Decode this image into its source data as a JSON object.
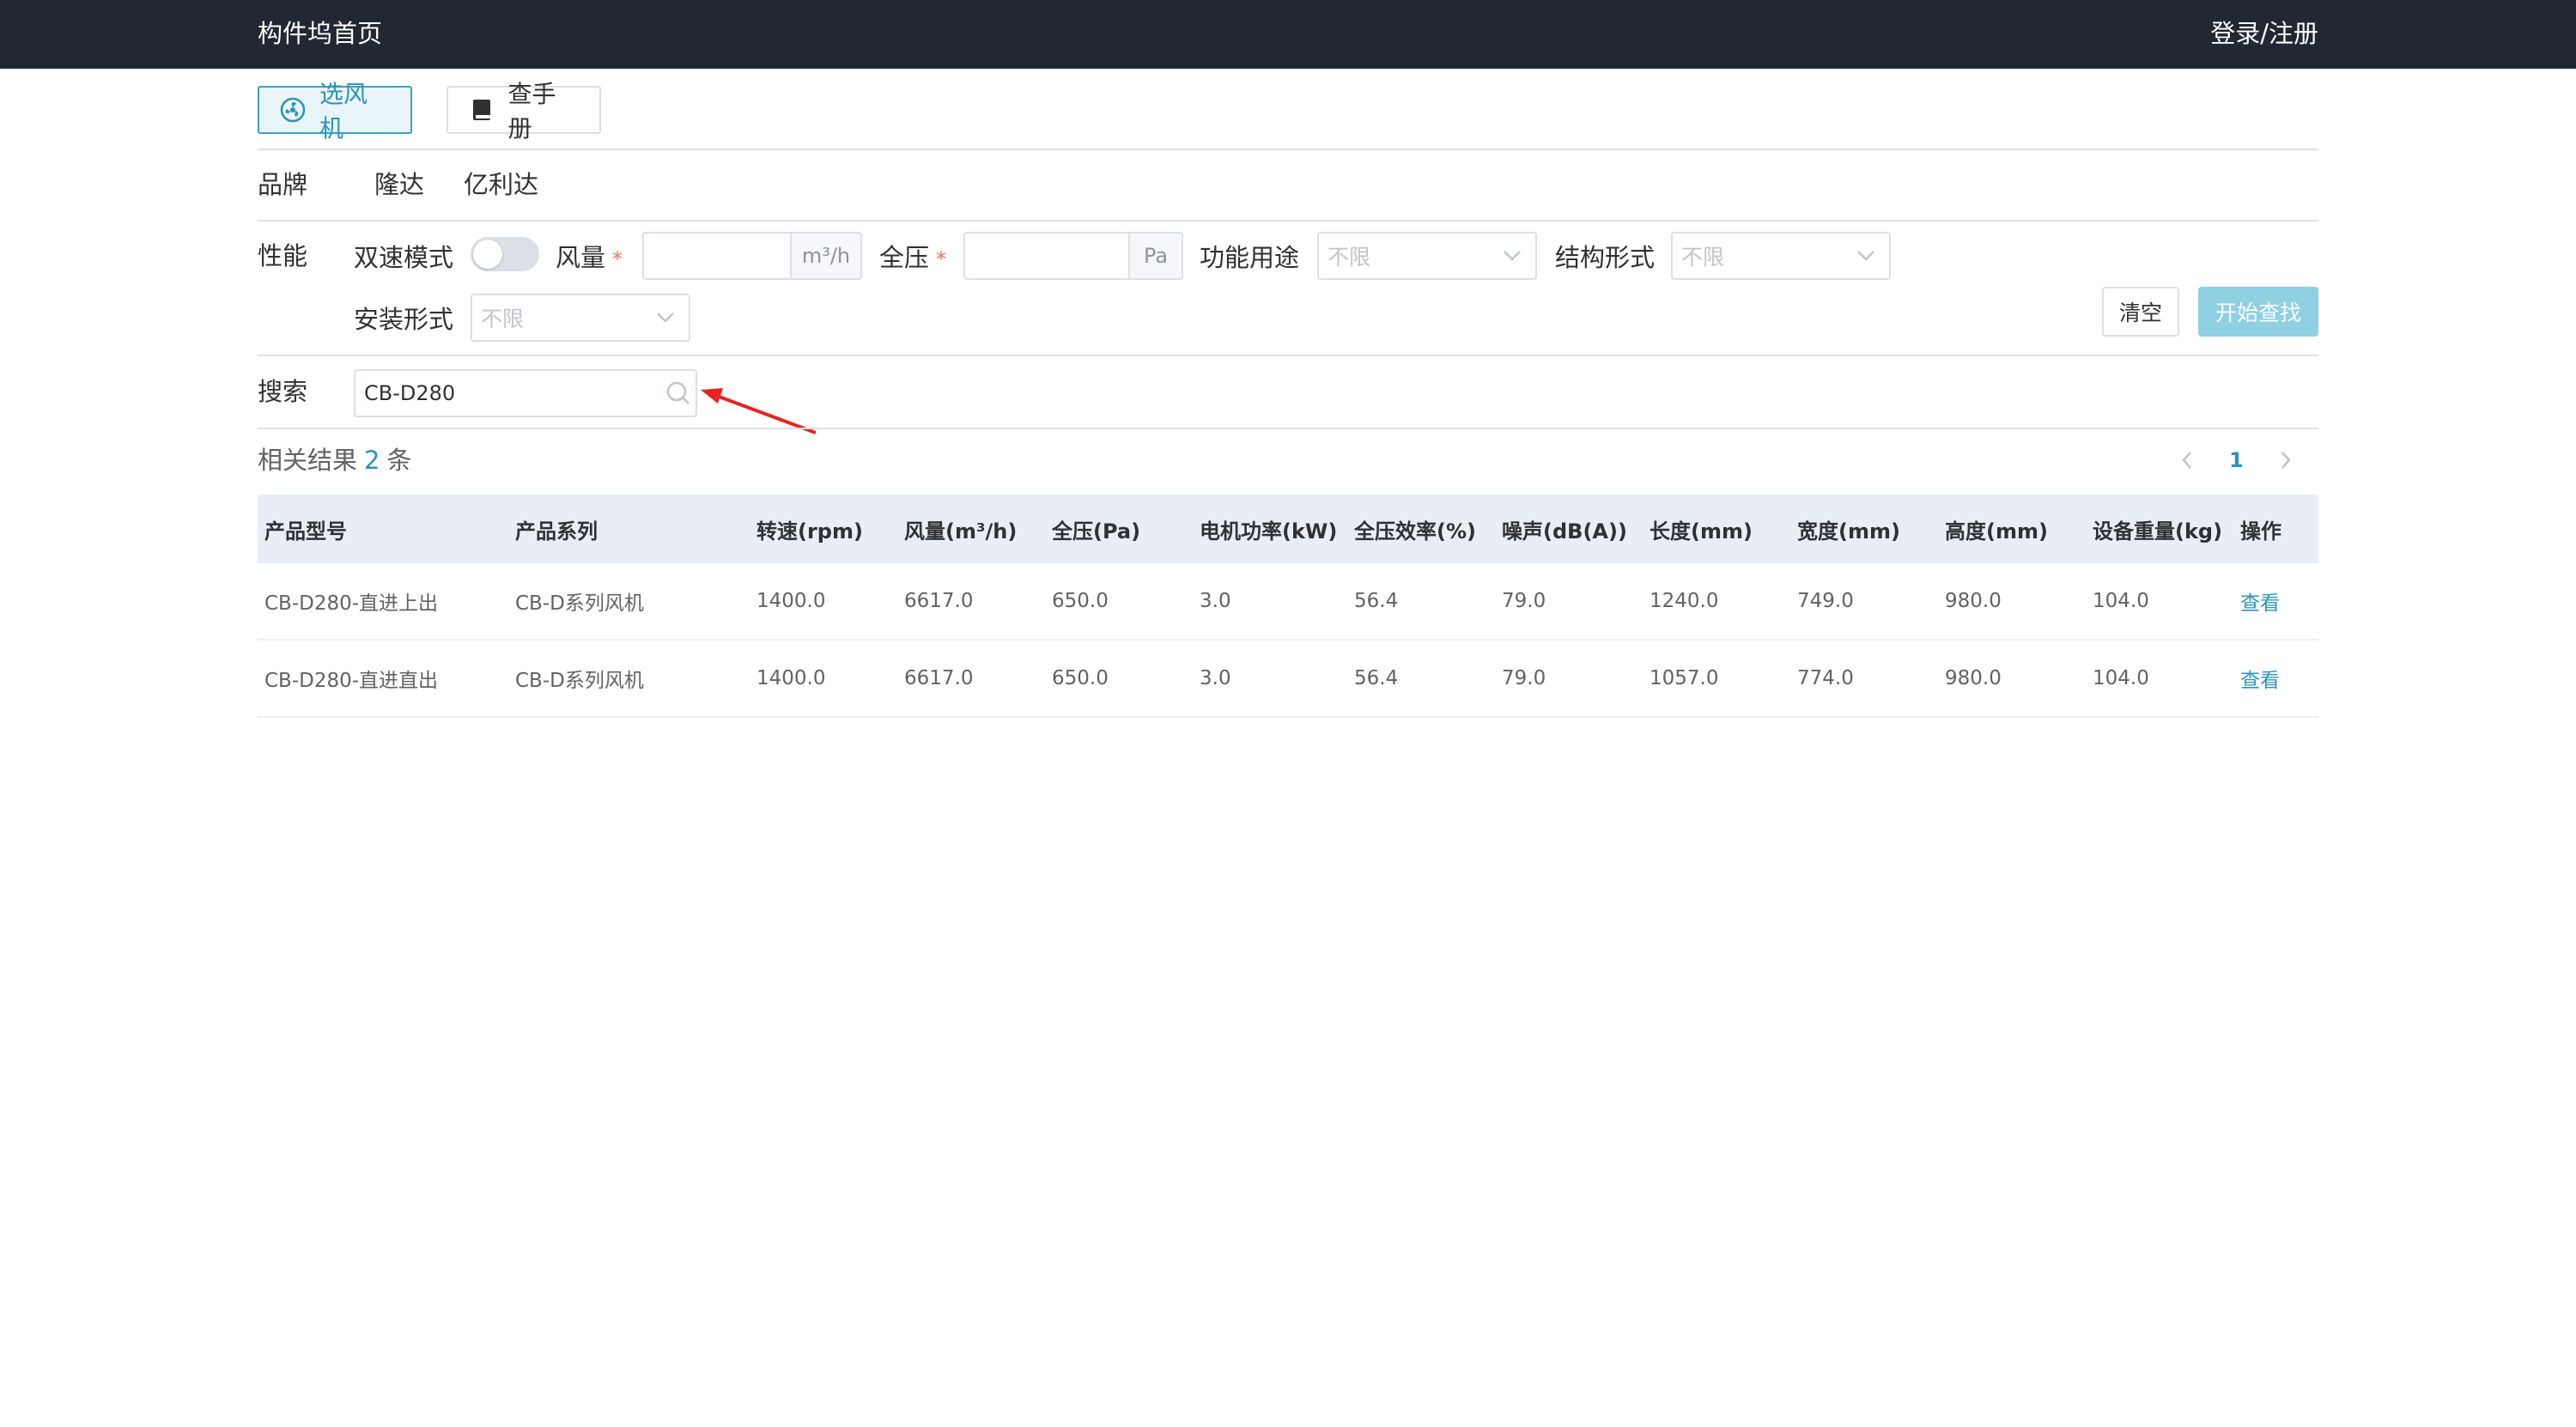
{
  "header": {
    "home_label": "构件坞首页",
    "login_label": "登录/注册"
  },
  "tabs": [
    {
      "label": "选风机",
      "icon": "fan-icon",
      "active": true
    },
    {
      "label": "查手册",
      "icon": "book-icon",
      "active": false
    }
  ],
  "brand": {
    "label": "品牌",
    "items": [
      "隆达",
      "亿利达"
    ]
  },
  "performance": {
    "label": "性能",
    "dual_speed_label": "双速模式",
    "dual_speed_on": false,
    "airflow_label": "风量",
    "airflow_unit": "m³/h",
    "airflow_value": "",
    "pressure_label": "全压",
    "pressure_unit": "Pa",
    "pressure_value": "",
    "required_mark": "*",
    "function_label": "功能用途",
    "function_value": "不限",
    "structure_label": "结构形式",
    "structure_value": "不限",
    "install_label": "安装形式",
    "install_value": "不限"
  },
  "actions": {
    "clear_label": "清空",
    "search_label": "开始查找"
  },
  "search": {
    "label": "搜索",
    "value": "CB-D280"
  },
  "results": {
    "prefix": "相关结果",
    "count": "2",
    "suffix": "条"
  },
  "pagination": {
    "current_page": "1"
  },
  "table": {
    "columns": [
      "产品型号",
      "产品系列",
      "转速(rpm)",
      "风量(m³/h)",
      "全压(Pa)",
      "电机功率(kW)",
      "全压效率(%)",
      "噪声(dB(A))",
      "长度(mm)",
      "宽度(mm)",
      "高度(mm)",
      "设备重量(kg)",
      "操作"
    ],
    "rows": [
      [
        "CB-D280-直进上出",
        "CB-D系列风机",
        "1400.0",
        "6617.0",
        "650.0",
        "3.0",
        "56.4",
        "79.0",
        "1240.0",
        "749.0",
        "980.0",
        "104.0",
        "查看"
      ],
      [
        "CB-D280-直进直出",
        "CB-D系列风机",
        "1400.0",
        "6617.0",
        "650.0",
        "3.0",
        "56.4",
        "79.0",
        "1057.0",
        "774.0",
        "980.0",
        "104.0",
        "查看"
      ]
    ]
  },
  "colors": {
    "topbar": "#222734",
    "accent": "#2b95b8",
    "table_header_bg": "#e9edf5",
    "search_button_bg": "#8fd0e3",
    "annotation_arrow": "#e8231f"
  }
}
